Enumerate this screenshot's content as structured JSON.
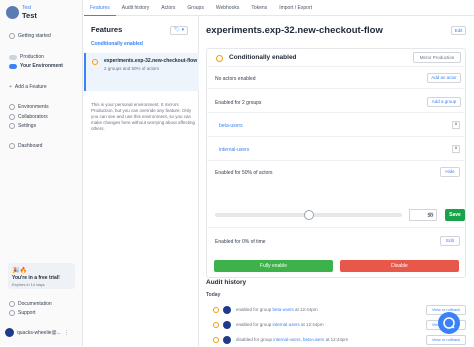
{
  "sidebar": {
    "project_env": "Test",
    "project_name": "Test",
    "nav": {
      "getting_started": "Getting started",
      "production": "Production",
      "your_environment": "Your Environment",
      "add_feature": "Add a Feature",
      "environments": "Environments",
      "collaborators": "Collaborators",
      "settings": "Settings",
      "dashboard": "Dashboard"
    },
    "trial": {
      "emoji": "🎉🔥",
      "title": "You're in a free trial!",
      "subtitle": "Expires in 14 days"
    },
    "documentation": "Documentation",
    "support": "Support",
    "user": "quacks-wheelie@..."
  },
  "tabs": [
    "Features",
    "Audit history",
    "Actors",
    "Groups",
    "Webhooks",
    "Tokens",
    "Import / Export"
  ],
  "feature_list": {
    "title": "Features",
    "tag_btn": "🏷 ▾",
    "section": "Conditionally enabled",
    "item": {
      "name": "experiments.exp-32.new-checkout-flow",
      "desc": "2 groups and 50% of actors"
    },
    "note": "This is your personal environment. It mirrors Production, but you can override any feature. Only you can see and use this environment, so you can make changes here without worrying about affecting others."
  },
  "feature": {
    "title": "experiments.exp-32.new-checkout-flow",
    "edit": "Edit",
    "status": "Conditionally enabled",
    "mirror": "Mirror Production",
    "no_actors": "No actors enabled",
    "add_actor": "Add an actor",
    "groups_header": "Enabled for 2 groups",
    "add_group": "Add a group",
    "groups": [
      "beta-users",
      "internal-users"
    ],
    "pct_actors_label": "Enabled for 50% of actors",
    "hide": "Hide",
    "percentage": 50,
    "pct_value": "50",
    "pct_sign": "%",
    "save": "Save",
    "time_label": "Enabled for 0% of time",
    "time_edit": "Edit",
    "fully_enable": "Fully enable",
    "disable": "Disable"
  },
  "audit": {
    "title": "Audit history",
    "today": "Today",
    "view_rollback": "View or rollback",
    "rows": [
      {
        "pre": "enabled for group ",
        "group": "beta-users",
        "post": " at 12:44pm"
      },
      {
        "pre": "enabled for group ",
        "group": "internal-users",
        "post": " at 12:44pm"
      },
      {
        "pre": "disabled for group ",
        "group": "internal-users, beta-users",
        "post": " at 12:44pm"
      }
    ]
  },
  "colors": {
    "accent": "#3b82f6",
    "success": "#3db24b",
    "danger": "#e8584a",
    "warning": "#f59e0b"
  }
}
